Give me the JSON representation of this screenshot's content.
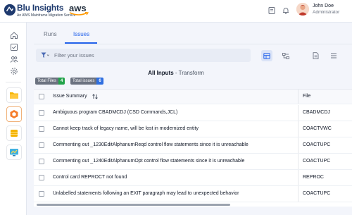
{
  "header": {
    "brand_name": "Blu Insights",
    "brand_subtitle": "An AWS Mainframe Migration Service",
    "aws_label": "aws",
    "user": {
      "name": "John Doe",
      "role": "Administrator"
    }
  },
  "tabs": [
    {
      "label": "Runs",
      "active": false
    },
    {
      "label": "Issues",
      "active": true
    }
  ],
  "filter": {
    "placeholder": "Filter your issues",
    "value": ""
  },
  "section": {
    "title_bold": "All Inputs",
    "title_rest": " - Transform"
  },
  "badges": {
    "total_files_label": "Total Files",
    "total_files_count": "4",
    "total_issues_label": "Total issues",
    "total_issues_count": "6"
  },
  "table": {
    "columns": [
      "Issue Summary",
      "File"
    ],
    "rows": [
      {
        "summary": "Ambiguous program CBADMCDJ (CSD Commands,JCL)",
        "file": "CBADMCDJ"
      },
      {
        "summary": "Cannot keep track of legacy name, will be lost in modernized entity",
        "file": "COACTVWC"
      },
      {
        "summary": "Commenting out _1230EditAlphanumReqd control flow statements since it is unreachable",
        "file": "COACTUPC"
      },
      {
        "summary": "Commenting out _1240EditAlphanumOpt control flow statements since it is unreachable",
        "file": "COACTUPC"
      },
      {
        "summary": "Control card REPROCT not found",
        "file": "REPROC"
      },
      {
        "summary": "Unlabelled statements following an EXIT paragraph may lead to unexpected behavior",
        "file": "COACTUPC"
      }
    ]
  },
  "colors": {
    "accent": "#2563eb",
    "files_badge": "#22a34a",
    "issues_badge": "#2f6fe0",
    "brand": "#1e3a6e"
  }
}
